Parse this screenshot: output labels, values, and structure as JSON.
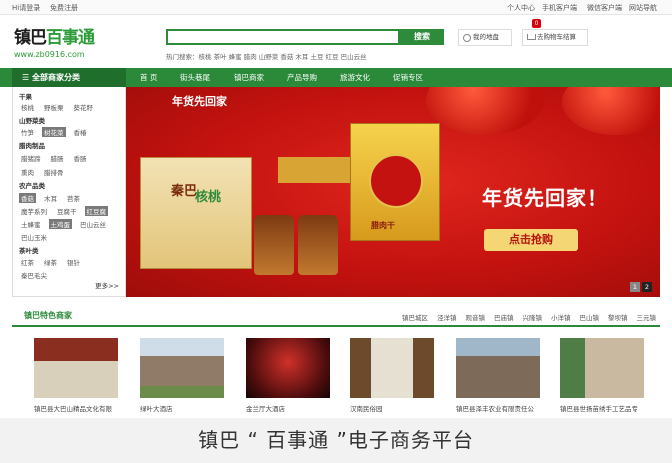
{
  "topbar": {
    "login": "Hi请登录",
    "register": "免费注册",
    "user_center": "个人中心",
    "mobile_client": "手机客户端",
    "wechat_client": "微信客户端",
    "site_nav": "网站导航"
  },
  "logo": {
    "brand_prefix": "镇巴",
    "brand_suffix": "百事通",
    "url": "www.zb0916.com"
  },
  "search": {
    "button": "搜索",
    "hot_label": "热门搜索：",
    "hot_words": "核桃 茶叶 蜂蜜 腊肉 山野菜 香菇 木耳 土豆 红豆 巴山云丝"
  },
  "mystore": "我的地盘",
  "cart": {
    "label": "去购物车结算",
    "count": "0"
  },
  "nav": {
    "all_categories": "全部商家分类",
    "items": [
      "首 页",
      "街头巷尾",
      "镇巴商家",
      "产品导购",
      "旅游文化",
      "促销专区"
    ]
  },
  "categories": [
    {
      "title": "干果",
      "items": [
        "核桃",
        "野板栗",
        "葵花籽"
      ]
    },
    {
      "title": "山野菜类",
      "items": [
        "竹笋",
        "树花菜",
        "香椿"
      ]
    },
    {
      "title": "腊肉制品",
      "items": [
        "腊猪蹄",
        "腊肠",
        "香肠"
      ]
    },
    {
      "title": "",
      "items": [
        "熏肉",
        "腊排骨"
      ]
    },
    {
      "title": "农产品类",
      "items": [
        "香菇",
        "木耳",
        "苕茶"
      ]
    },
    {
      "title": "",
      "items": [
        "魔芋系列",
        "豆腐干",
        "红豆腐"
      ]
    },
    {
      "title": "",
      "items": [
        "土蜂蜜",
        "土鸡蛋",
        "巴山云丝"
      ]
    },
    {
      "title": "",
      "items": [
        "巴山玉米"
      ]
    },
    {
      "title": "茶叶类",
      "items": [
        "红茶",
        "绿茶",
        "银针"
      ]
    },
    {
      "title": "",
      "items": [
        "秦巴毛尖"
      ]
    }
  ],
  "more": "更多>>",
  "banner": {
    "tag": "年货先回家",
    "slogan": "年货先回家！",
    "cta": "点击抢购",
    "pages": [
      "1",
      "2"
    ],
    "box_label": "秦巴",
    "box_label2": "核桃",
    "box3_label": "腊肉干"
  },
  "section": {
    "title": "镇巴特色商家",
    "links": [
      "镇巴城区",
      "泾洋镇",
      "观音镇",
      "巴庙镇",
      "兴隆镇",
      "小洋镇",
      "巴山镇",
      "黎坝镇",
      "三元镇"
    ]
  },
  "merchants": [
    {
      "name": "镇巴县大巴山精品文化有限"
    },
    {
      "name": "绿叶大酒店"
    },
    {
      "name": "金兰厅大酒店"
    },
    {
      "name": "汉南民俗园"
    },
    {
      "name": "镇巴县泽丰农业有限责任公"
    },
    {
      "name": "镇巴县世扬苗绣手工艺品专"
    }
  ],
  "caption": "镇巴 “ 百事通 ”电子商务平台"
}
